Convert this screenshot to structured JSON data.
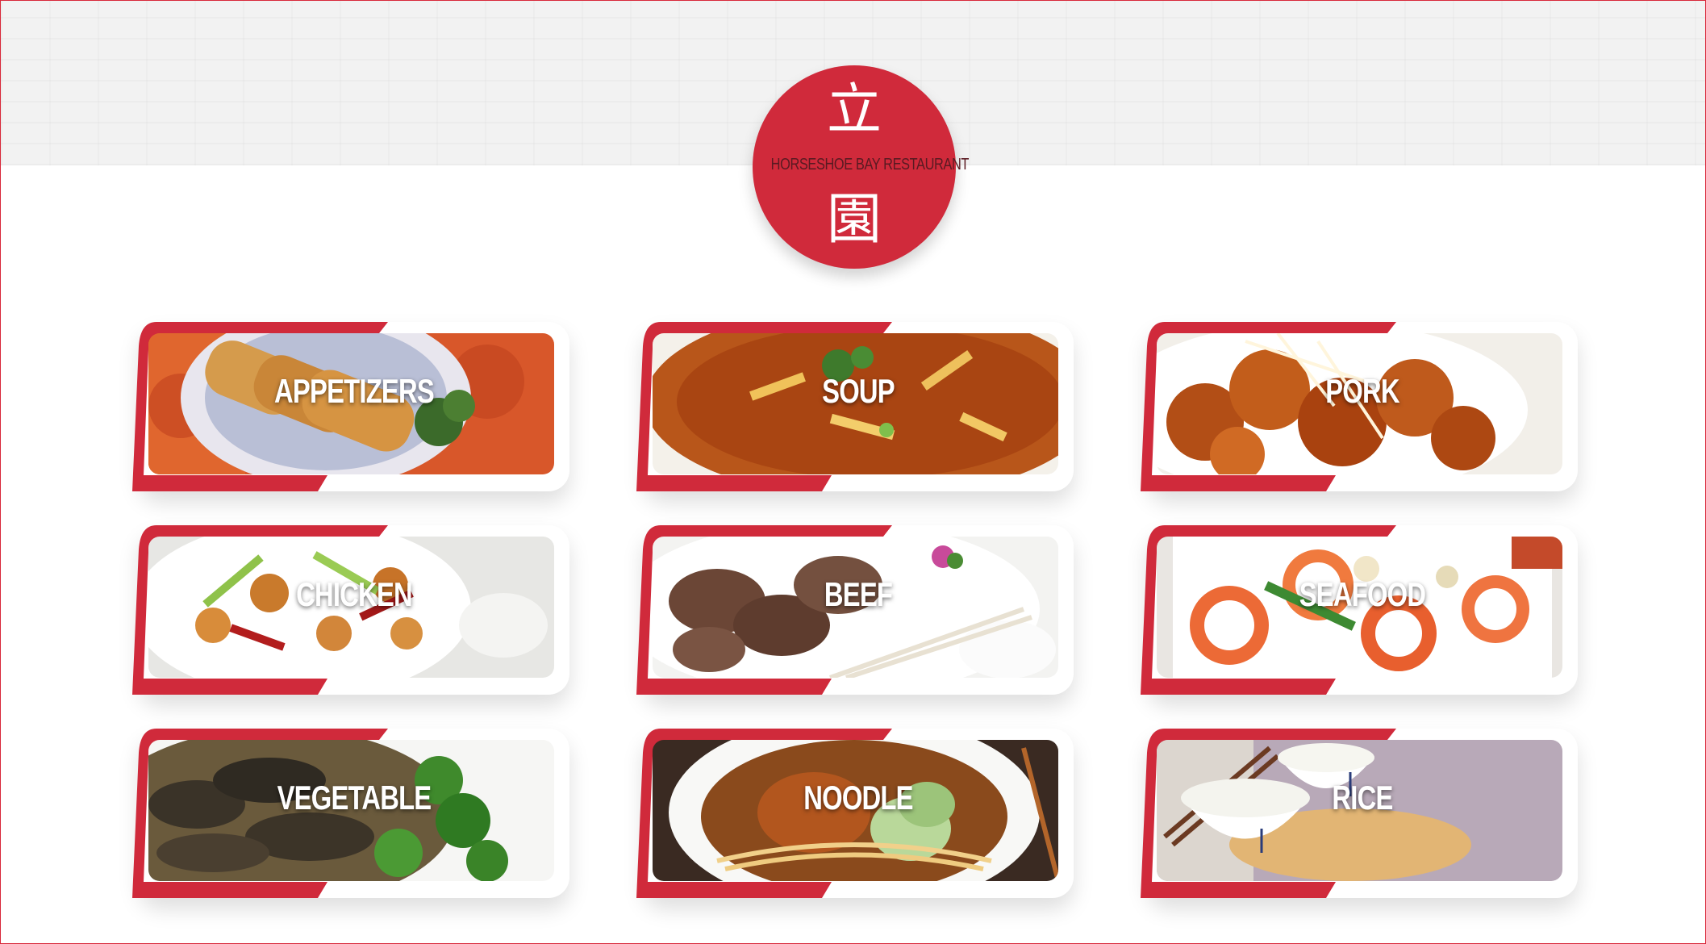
{
  "logo": {
    "glyph_top": "立",
    "glyph_bottom": "園",
    "name": "HORSESHOE BAY RESTAURANT"
  },
  "colors": {
    "accent": "#d02a3b",
    "card_background": "#ffffff",
    "header_band": "#f2f2f2"
  },
  "categories": [
    {
      "label": "APPETIZERS",
      "image": "spring-rolls-photo"
    },
    {
      "label": "SOUP",
      "image": "hot-sour-soup-photo"
    },
    {
      "label": "PORK",
      "image": "glazed-pork-photo"
    },
    {
      "label": "CHICKEN",
      "image": "kung-pao-chicken-photo"
    },
    {
      "label": "BEEF",
      "image": "sliced-beef-photo"
    },
    {
      "label": "SEAFOOD",
      "image": "shrimp-stir-fry-photo"
    },
    {
      "label": "VEGETABLE",
      "image": "mushroom-broccoli-photo"
    },
    {
      "label": "NOODLE",
      "image": "noodle-soup-photo"
    },
    {
      "label": "RICE",
      "image": "rice-bowls-photo"
    }
  ]
}
